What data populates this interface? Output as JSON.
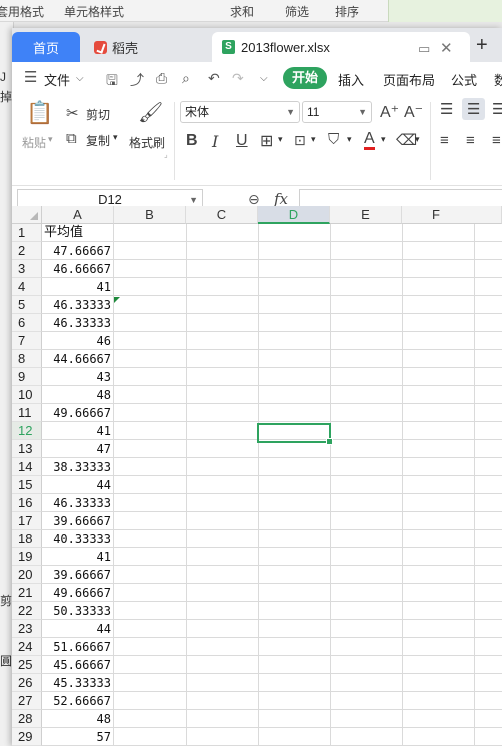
{
  "background": {
    "top_items": [
      "套用格式",
      "单元格样式",
      "求和",
      "筛选",
      "排序"
    ],
    "left_glyphs": [
      "J",
      "掉",
      "剪",
      "圓"
    ]
  },
  "tabs": {
    "home": "首页",
    "daoke": "稻壳",
    "file": "2013flower.xlsx",
    "new_tab": "+"
  },
  "menu": {
    "file": "文件",
    "start": "开始",
    "insert": "插入",
    "page_layout": "页面布局",
    "formula": "公式",
    "data": "数"
  },
  "ribbon": {
    "paste": "粘贴",
    "cut": "剪切",
    "copy": "复制",
    "format_painter": "格式刷",
    "font_name": "宋体",
    "font_size": "11",
    "bold": "B",
    "italic": "I",
    "underline": "U",
    "font_color_letter": "A"
  },
  "formula_bar": {
    "name_box": "D12",
    "fx_label": "fx",
    "content": ""
  },
  "grid": {
    "columns": [
      "A",
      "B",
      "C",
      "D",
      "E",
      "F"
    ],
    "selected_column": "D",
    "selected_row": 12,
    "rows": [
      {
        "n": "1",
        "a": "平均值"
      },
      {
        "n": "2",
        "a": "47.66667"
      },
      {
        "n": "3",
        "a": "46.66667"
      },
      {
        "n": "4",
        "a": "41"
      },
      {
        "n": "5",
        "a": "46.33333"
      },
      {
        "n": "6",
        "a": "46.33333"
      },
      {
        "n": "7",
        "a": "46"
      },
      {
        "n": "8",
        "a": "44.66667"
      },
      {
        "n": "9",
        "a": "43"
      },
      {
        "n": "10",
        "a": "48"
      },
      {
        "n": "11",
        "a": "49.66667"
      },
      {
        "n": "12",
        "a": "41"
      },
      {
        "n": "13",
        "a": "47"
      },
      {
        "n": "14",
        "a": "38.33333"
      },
      {
        "n": "15",
        "a": "44"
      },
      {
        "n": "16",
        "a": "46.33333"
      },
      {
        "n": "17",
        "a": "39.66667"
      },
      {
        "n": "18",
        "a": "40.33333"
      },
      {
        "n": "19",
        "a": "41"
      },
      {
        "n": "20",
        "a": "39.66667"
      },
      {
        "n": "21",
        "a": "49.66667"
      },
      {
        "n": "22",
        "a": "50.33333"
      },
      {
        "n": "23",
        "a": "44"
      },
      {
        "n": "24",
        "a": "51.66667"
      },
      {
        "n": "25",
        "a": "45.66667"
      },
      {
        "n": "26",
        "a": "45.33333"
      },
      {
        "n": "27",
        "a": "52.66667"
      },
      {
        "n": "28",
        "a": "48"
      },
      {
        "n": "29",
        "a": "57"
      }
    ]
  },
  "colors": {
    "accent_green": "#2ea35f",
    "home_tab_blue": "#3f82f7"
  }
}
